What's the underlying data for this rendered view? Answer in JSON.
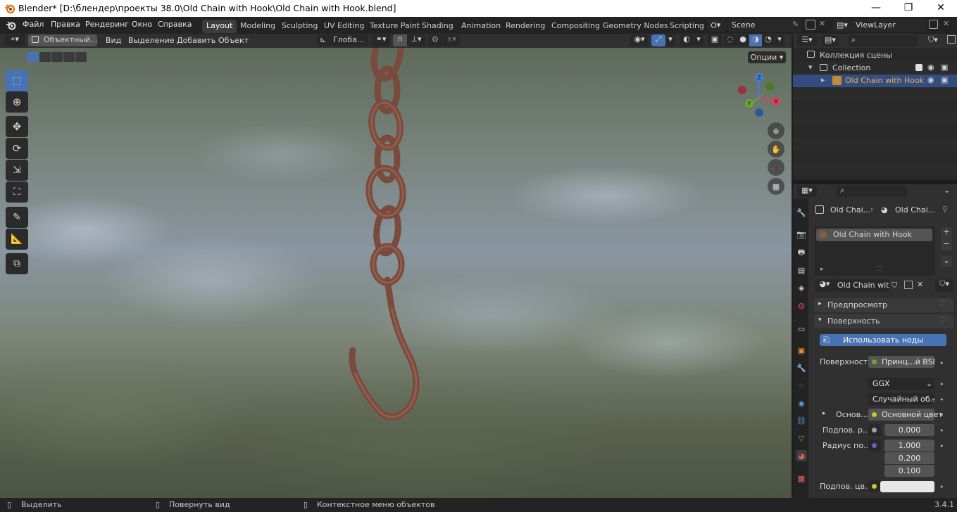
{
  "window": {
    "title": "Blender* [D:\\блендер\\проекты 38.0\\Old Chain with Hook\\Old Chain with Hook.blend]",
    "minimize": "—",
    "maximize": "❐",
    "close": "✕"
  },
  "menu": {
    "items": [
      "Файл",
      "Правка",
      "Рендеринг",
      "Окно",
      "Справка"
    ],
    "workspaces": [
      "Layout",
      "Modeling",
      "Sculpting",
      "UV Editing",
      "Texture Paint",
      "Shading",
      "Animation",
      "Rendering",
      "Compositing",
      "Geometry Nodes",
      "Scripting"
    ],
    "active_workspace": "Layout",
    "scene": "Scene",
    "view_layer": "ViewLayer"
  },
  "viewport_header": {
    "mode": "Объектный...",
    "menus": [
      "Вид",
      "Выделение",
      "Добавить",
      "Объект"
    ],
    "orientation": "Глоба...",
    "options": "Опции"
  },
  "outliner": {
    "root": "Коллекция сцены",
    "collection": "Collection",
    "object": "Old Chain with Hook"
  },
  "properties": {
    "breadcrumb_object": "Old Chai...",
    "breadcrumb_material": "Old Chai...",
    "slot_name": "Old Chain with Hook",
    "material_name": "Old Chain wit...",
    "preview_panel": "Предпросмотр",
    "surface_panel": "Поверхность",
    "use_nodes": "Использовать ноды",
    "surface_label": "Поверхность",
    "surface_value": "Принц...й BSDF",
    "distribution": "GGX",
    "subsurface_method": "Случайный об...",
    "base_label": "Основ...",
    "base_value": "Основной цвет",
    "subsurface_label": "Подпов. р...",
    "subsurface_value": "0.000",
    "radius_label": "Радиус по...",
    "radius_values": [
      "1.000",
      "0.200",
      "0.100"
    ],
    "subsurface_color_label": "Подпов. цв..."
  },
  "status": {
    "select": "Выделить",
    "rotate": "Повернуть вид",
    "context": "Контекстное меню объектов",
    "version": "3.4.1"
  },
  "colors": {
    "accent": "#4772b3",
    "active_object": "#f0b050",
    "axis_x": "#d9435a",
    "axis_y": "#6ea632",
    "axis_z": "#3e7fd8"
  }
}
